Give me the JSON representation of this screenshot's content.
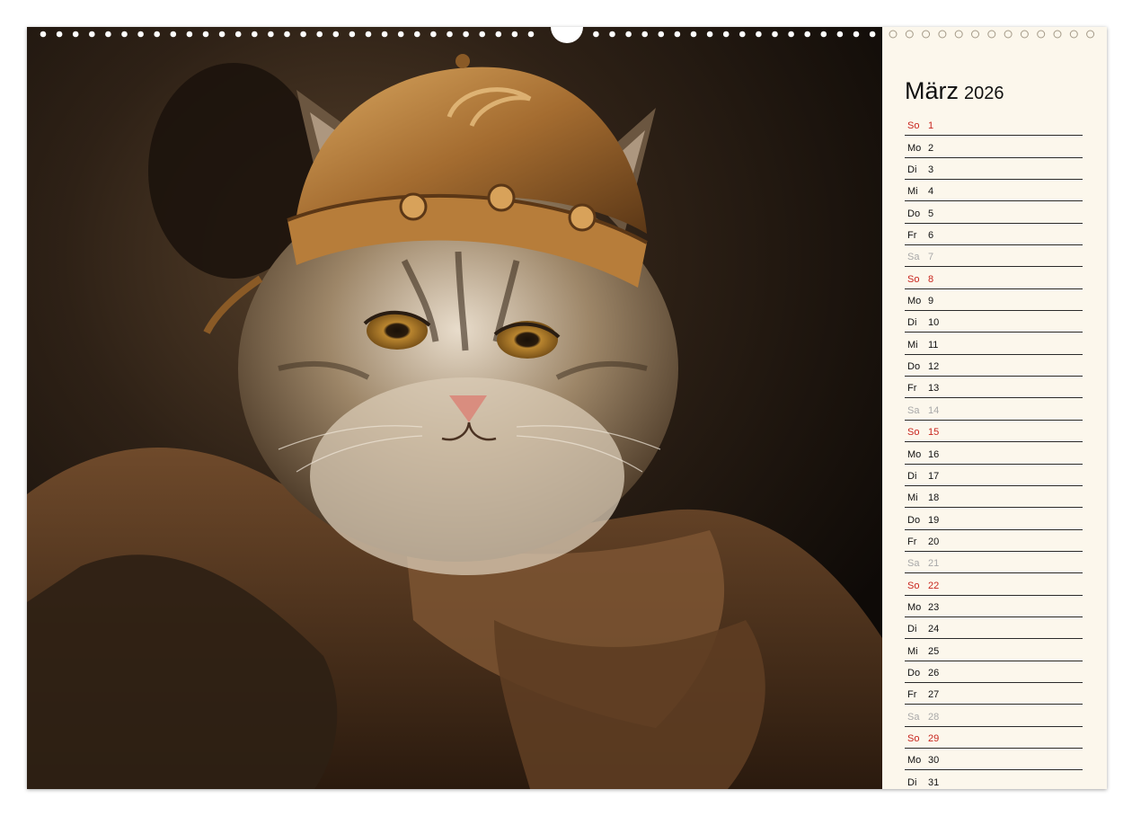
{
  "calendar": {
    "month": "März",
    "year": "2026",
    "days": [
      {
        "wd": "So",
        "d": "1",
        "kind": "sun"
      },
      {
        "wd": "Mo",
        "d": "2",
        "kind": "weekday"
      },
      {
        "wd": "Di",
        "d": "3",
        "kind": "weekday"
      },
      {
        "wd": "Mi",
        "d": "4",
        "kind": "weekday"
      },
      {
        "wd": "Do",
        "d": "5",
        "kind": "weekday"
      },
      {
        "wd": "Fr",
        "d": "6",
        "kind": "weekday"
      },
      {
        "wd": "Sa",
        "d": "7",
        "kind": "sat"
      },
      {
        "wd": "So",
        "d": "8",
        "kind": "sun"
      },
      {
        "wd": "Mo",
        "d": "9",
        "kind": "weekday"
      },
      {
        "wd": "Di",
        "d": "10",
        "kind": "weekday"
      },
      {
        "wd": "Mi",
        "d": "11",
        "kind": "weekday"
      },
      {
        "wd": "Do",
        "d": "12",
        "kind": "weekday"
      },
      {
        "wd": "Fr",
        "d": "13",
        "kind": "weekday"
      },
      {
        "wd": "Sa",
        "d": "14",
        "kind": "sat"
      },
      {
        "wd": "So",
        "d": "15",
        "kind": "sun"
      },
      {
        "wd": "Mo",
        "d": "16",
        "kind": "weekday"
      },
      {
        "wd": "Di",
        "d": "17",
        "kind": "weekday"
      },
      {
        "wd": "Mi",
        "d": "18",
        "kind": "weekday"
      },
      {
        "wd": "Do",
        "d": "19",
        "kind": "weekday"
      },
      {
        "wd": "Fr",
        "d": "20",
        "kind": "weekday"
      },
      {
        "wd": "Sa",
        "d": "21",
        "kind": "sat"
      },
      {
        "wd": "So",
        "d": "22",
        "kind": "sun"
      },
      {
        "wd": "Mo",
        "d": "23",
        "kind": "weekday"
      },
      {
        "wd": "Di",
        "d": "24",
        "kind": "weekday"
      },
      {
        "wd": "Mi",
        "d": "25",
        "kind": "weekday"
      },
      {
        "wd": "Do",
        "d": "26",
        "kind": "weekday"
      },
      {
        "wd": "Fr",
        "d": "27",
        "kind": "weekday"
      },
      {
        "wd": "Sa",
        "d": "28",
        "kind": "sat"
      },
      {
        "wd": "So",
        "d": "29",
        "kind": "sun"
      },
      {
        "wd": "Mo",
        "d": "30",
        "kind": "weekday"
      },
      {
        "wd": "Di",
        "d": "31",
        "kind": "weekday"
      }
    ]
  },
  "colors": {
    "sunday": "#c8261e",
    "saturday": "#a8a8a8",
    "panel_background": "#fcf7ec"
  },
  "illustration": "cat-in-viking-helmet-portrait"
}
